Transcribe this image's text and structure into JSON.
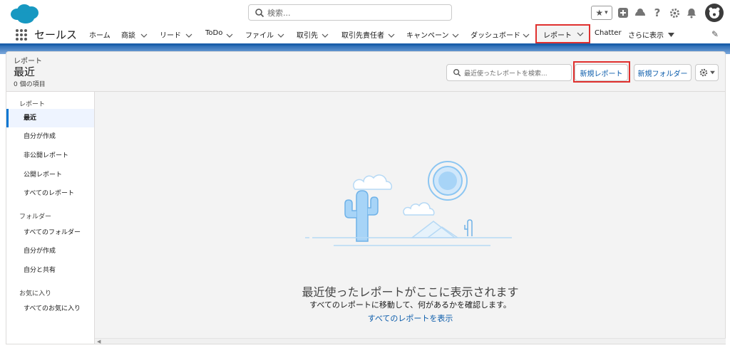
{
  "topbar": {
    "search_placeholder": "検索...",
    "favorites_star": "★",
    "favorites_dropdown": "▾"
  },
  "nav": {
    "app_name": "セールス",
    "items": [
      {
        "label": "ホーム"
      },
      {
        "label": "商談"
      },
      {
        "label": "リード"
      },
      {
        "label": "ToDo"
      },
      {
        "label": "ファイル"
      },
      {
        "label": "取引先"
      },
      {
        "label": "取引先責任者"
      },
      {
        "label": "キャンペーン"
      },
      {
        "label": "ダッシュボード"
      },
      {
        "label": "レポート"
      },
      {
        "label": "Chatter"
      },
      {
        "label": "さらに表示"
      }
    ]
  },
  "header": {
    "object_label": "レポート",
    "title": "最近",
    "count": "0 個の項目",
    "search_placeholder": "最近使ったレポートを検索...",
    "new_report_label": "新規レポート",
    "new_folder_label": "新規フォルダー"
  },
  "sidebar": {
    "reports_section": "レポート",
    "report_items": [
      {
        "label": "最近"
      },
      {
        "label": "自分が作成"
      },
      {
        "label": "非公開レポート"
      },
      {
        "label": "公開レポート"
      },
      {
        "label": "すべてのレポート"
      }
    ],
    "folders_section": "フォルダー",
    "folder_items": [
      {
        "label": "すべてのフォルダー"
      },
      {
        "label": "自分が作成"
      },
      {
        "label": "自分と共有"
      }
    ],
    "favorites_section": "お気に入り",
    "favorite_items": [
      {
        "label": "すべてのお気に入り"
      }
    ]
  },
  "empty_state": {
    "title": "最近使ったレポートがここに表示されます",
    "subtitle": "すべてのレポートに移動して、何があるかを確認します。",
    "link": "すべてのレポートを表示"
  },
  "colors": {
    "brand_blue": "#1b5faa",
    "link_blue": "#0b5cab",
    "highlight_red": "#e0302e",
    "salesforce_cloud": "#1798c1"
  }
}
